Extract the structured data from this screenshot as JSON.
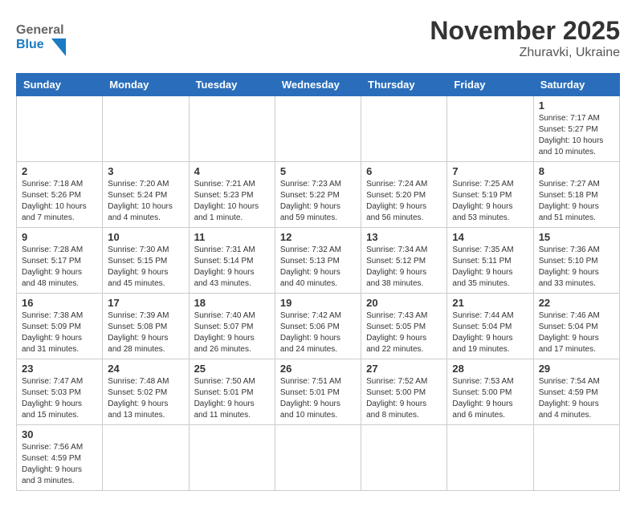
{
  "header": {
    "logo_general": "General",
    "logo_blue": "Blue",
    "month_title": "November 2025",
    "location": "Zhuravki, Ukraine"
  },
  "weekdays": [
    "Sunday",
    "Monday",
    "Tuesday",
    "Wednesday",
    "Thursday",
    "Friday",
    "Saturday"
  ],
  "weeks": [
    [
      {
        "day": "",
        "info": ""
      },
      {
        "day": "",
        "info": ""
      },
      {
        "day": "",
        "info": ""
      },
      {
        "day": "",
        "info": ""
      },
      {
        "day": "",
        "info": ""
      },
      {
        "day": "",
        "info": ""
      },
      {
        "day": "1",
        "info": "Sunrise: 7:17 AM\nSunset: 5:27 PM\nDaylight: 10 hours\nand 10 minutes."
      }
    ],
    [
      {
        "day": "2",
        "info": "Sunrise: 7:18 AM\nSunset: 5:26 PM\nDaylight: 10 hours\nand 7 minutes."
      },
      {
        "day": "3",
        "info": "Sunrise: 7:20 AM\nSunset: 5:24 PM\nDaylight: 10 hours\nand 4 minutes."
      },
      {
        "day": "4",
        "info": "Sunrise: 7:21 AM\nSunset: 5:23 PM\nDaylight: 10 hours\nand 1 minute."
      },
      {
        "day": "5",
        "info": "Sunrise: 7:23 AM\nSunset: 5:22 PM\nDaylight: 9 hours\nand 59 minutes."
      },
      {
        "day": "6",
        "info": "Sunrise: 7:24 AM\nSunset: 5:20 PM\nDaylight: 9 hours\nand 56 minutes."
      },
      {
        "day": "7",
        "info": "Sunrise: 7:25 AM\nSunset: 5:19 PM\nDaylight: 9 hours\nand 53 minutes."
      },
      {
        "day": "8",
        "info": "Sunrise: 7:27 AM\nSunset: 5:18 PM\nDaylight: 9 hours\nand 51 minutes."
      }
    ],
    [
      {
        "day": "9",
        "info": "Sunrise: 7:28 AM\nSunset: 5:17 PM\nDaylight: 9 hours\nand 48 minutes."
      },
      {
        "day": "10",
        "info": "Sunrise: 7:30 AM\nSunset: 5:15 PM\nDaylight: 9 hours\nand 45 minutes."
      },
      {
        "day": "11",
        "info": "Sunrise: 7:31 AM\nSunset: 5:14 PM\nDaylight: 9 hours\nand 43 minutes."
      },
      {
        "day": "12",
        "info": "Sunrise: 7:32 AM\nSunset: 5:13 PM\nDaylight: 9 hours\nand 40 minutes."
      },
      {
        "day": "13",
        "info": "Sunrise: 7:34 AM\nSunset: 5:12 PM\nDaylight: 9 hours\nand 38 minutes."
      },
      {
        "day": "14",
        "info": "Sunrise: 7:35 AM\nSunset: 5:11 PM\nDaylight: 9 hours\nand 35 minutes."
      },
      {
        "day": "15",
        "info": "Sunrise: 7:36 AM\nSunset: 5:10 PM\nDaylight: 9 hours\nand 33 minutes."
      }
    ],
    [
      {
        "day": "16",
        "info": "Sunrise: 7:38 AM\nSunset: 5:09 PM\nDaylight: 9 hours\nand 31 minutes."
      },
      {
        "day": "17",
        "info": "Sunrise: 7:39 AM\nSunset: 5:08 PM\nDaylight: 9 hours\nand 28 minutes."
      },
      {
        "day": "18",
        "info": "Sunrise: 7:40 AM\nSunset: 5:07 PM\nDaylight: 9 hours\nand 26 minutes."
      },
      {
        "day": "19",
        "info": "Sunrise: 7:42 AM\nSunset: 5:06 PM\nDaylight: 9 hours\nand 24 minutes."
      },
      {
        "day": "20",
        "info": "Sunrise: 7:43 AM\nSunset: 5:05 PM\nDaylight: 9 hours\nand 22 minutes."
      },
      {
        "day": "21",
        "info": "Sunrise: 7:44 AM\nSunset: 5:04 PM\nDaylight: 9 hours\nand 19 minutes."
      },
      {
        "day": "22",
        "info": "Sunrise: 7:46 AM\nSunset: 5:04 PM\nDaylight: 9 hours\nand 17 minutes."
      }
    ],
    [
      {
        "day": "23",
        "info": "Sunrise: 7:47 AM\nSunset: 5:03 PM\nDaylight: 9 hours\nand 15 minutes."
      },
      {
        "day": "24",
        "info": "Sunrise: 7:48 AM\nSunset: 5:02 PM\nDaylight: 9 hours\nand 13 minutes."
      },
      {
        "day": "25",
        "info": "Sunrise: 7:50 AM\nSunset: 5:01 PM\nDaylight: 9 hours\nand 11 minutes."
      },
      {
        "day": "26",
        "info": "Sunrise: 7:51 AM\nSunset: 5:01 PM\nDaylight: 9 hours\nand 10 minutes."
      },
      {
        "day": "27",
        "info": "Sunrise: 7:52 AM\nSunset: 5:00 PM\nDaylight: 9 hours\nand 8 minutes."
      },
      {
        "day": "28",
        "info": "Sunrise: 7:53 AM\nSunset: 5:00 PM\nDaylight: 9 hours\nand 6 minutes."
      },
      {
        "day": "29",
        "info": "Sunrise: 7:54 AM\nSunset: 4:59 PM\nDaylight: 9 hours\nand 4 minutes."
      }
    ],
    [
      {
        "day": "30",
        "info": "Sunrise: 7:56 AM\nSunset: 4:59 PM\nDaylight: 9 hours\nand 3 minutes."
      },
      {
        "day": "",
        "info": ""
      },
      {
        "day": "",
        "info": ""
      },
      {
        "day": "",
        "info": ""
      },
      {
        "day": "",
        "info": ""
      },
      {
        "day": "",
        "info": ""
      },
      {
        "day": "",
        "info": ""
      }
    ]
  ]
}
